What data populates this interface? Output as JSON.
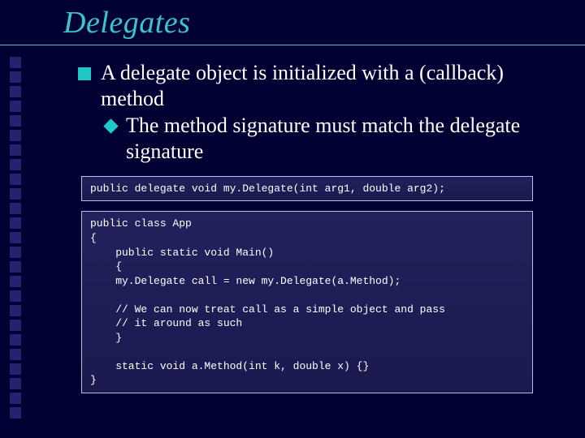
{
  "slide": {
    "title": "Delegates",
    "bullets": {
      "0": {
        "text": "A delegate object is initialized with a (callback) method"
      },
      "0_0": {
        "text": "The method signature must match the delegate signature"
      }
    },
    "code": {
      "block1": "public delegate void my.Delegate(int arg1, double arg2);",
      "block2": "public class App\n{\n    public static void Main()\n    {\n    my.Delegate call = new my.Delegate(a.Method);\n\n    // We can now treat call as a simple object and pass\n    // it around as such\n    }\n\n    static void a.Method(int k, double x) {}\n}"
    }
  }
}
